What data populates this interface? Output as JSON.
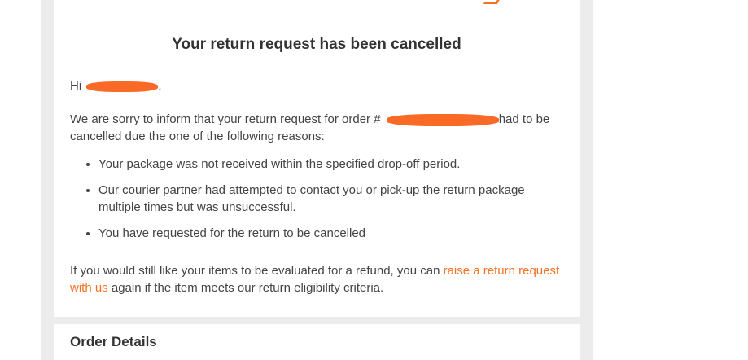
{
  "email": {
    "headline": "Your return request has been cancelled",
    "greeting_prefix": "Hi ",
    "greeting_suffix": ",",
    "intro_before": "We are sorry to inform that your return request for order # ",
    "intro_after": "had to be cancelled due the one of the following reasons:",
    "reasons": [
      "Your package was not received within the specified drop-off period.",
      "Our courier partner had attempted to contact you or pick-up the return package multiple times but was unsuccessful.",
      "You have requested for the return to be cancelled"
    ],
    "closing_before": "If you would still like your items to be evaluated for a refund, you can ",
    "closing_link": "raise a return request with us",
    "closing_after": " again if the item meets our return eligibility criteria.",
    "order_details_title": "Order Details"
  },
  "colors": {
    "accent": "#f57224",
    "redaction": "#f96a26",
    "text": "#444444",
    "heading": "#333333"
  }
}
